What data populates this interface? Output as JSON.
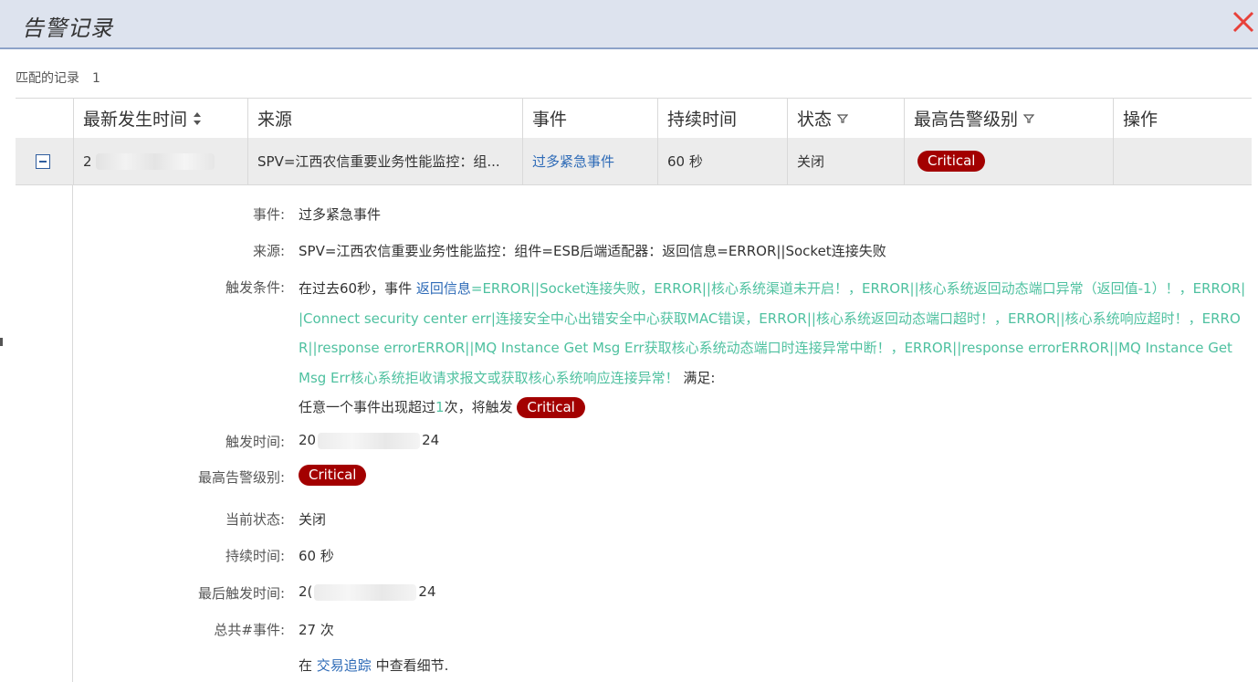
{
  "window": {
    "title": "告警记录",
    "close_icon": "close-icon",
    "close_color": "#e8413a"
  },
  "summary": {
    "label": "匹配的记录",
    "count": "1"
  },
  "table": {
    "headers": {
      "time": "最新发生时间",
      "source": "来源",
      "event": "事件",
      "duration": "持续时间",
      "status": "状态",
      "level": "最高告警级别",
      "action": "操作"
    },
    "row": {
      "time_prefix": "2",
      "source": "SPV=江西农信重要业务性能监控：组...",
      "event": "过多紧急事件",
      "duration": "60 秒",
      "status": "关闭",
      "level": "Critical",
      "action": ""
    }
  },
  "detail": {
    "event_label": "事件:",
    "event_value": "过多紧急事件",
    "source_label": "来源:",
    "source_value": "SPV=江西农信重要业务性能监控：组件=ESB后端适配器：返回信息=ERROR||Socket连接失败",
    "condition_label": "触发条件:",
    "condition_prefix": "在过去60秒，事件 ",
    "condition_link": "返回信息",
    "condition_items": "=ERROR||Socket连接失败，ERROR||核心系统渠道未开启！，ERROR||核心系统返回动态端口异常（返回值-1）！，ERROR||Connect security center err|连接安全中心出错安全中心获取MAC错误，ERROR||核心系统返回动态端口超时！，ERROR||核心系统响应超时！，ERROR||response errorERROR||MQ Instance Get Msg Err获取核心系统动态端口时连接异常中断！，ERROR||response errorERROR||MQ Instance Get Msg Err核心系统拒收请求报文或获取核心系统响应连接异常！",
    "condition_suffix": " 满足:",
    "condition_rule_a": "任意一个事件出现超过",
    "condition_rule_n": "1",
    "condition_rule_b": "次，将触发 ",
    "condition_level": "Critical",
    "trigger_time_label": "触发时间:",
    "trigger_time_prefix": "20",
    "trigger_time_suffix": "24",
    "max_level_label": "最高告警级别:",
    "max_level": "Critical",
    "state_label": "当前状态:",
    "state_value": "关闭",
    "duration_label": "持续时间:",
    "duration_value": "60 秒",
    "last_trigger_label": "最后触发时间:",
    "last_trigger_prefix": "2(",
    "last_trigger_suffix": "24",
    "total_label": "总共#事件:",
    "total_value": "27 次",
    "trace_prefix": "在 ",
    "trace_link": "交易追踪",
    "trace_suffix": " 中查看细节."
  },
  "colors": {
    "critical": "#a30000",
    "link": "#2e6bb7",
    "event_green": "#4fc1a0",
    "header_bg": "#dde3ee"
  }
}
